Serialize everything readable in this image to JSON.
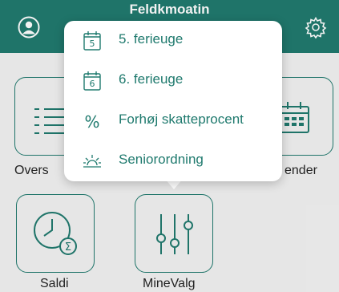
{
  "header": {
    "title": "Feldkmoatin"
  },
  "tiles": {
    "oversigt": "Overs",
    "kalender": "ender",
    "saldi": "Saldi",
    "minevalg": "MineValg"
  },
  "menu": {
    "items": [
      {
        "label": "5. ferieuge",
        "icon": "calendar-5-icon",
        "icon_text": "5"
      },
      {
        "label": "6. ferieuge",
        "icon": "calendar-6-icon",
        "icon_text": "6"
      },
      {
        "label": "Forhøj skatteprocent",
        "icon": "percent-icon",
        "icon_text": "%"
      },
      {
        "label": "Seniorordning",
        "icon": "sunrise-icon"
      }
    ]
  },
  "colors": {
    "accent": "#1f7a6e",
    "background": "#f3f3f3",
    "menu_bg": "#ffffff"
  }
}
